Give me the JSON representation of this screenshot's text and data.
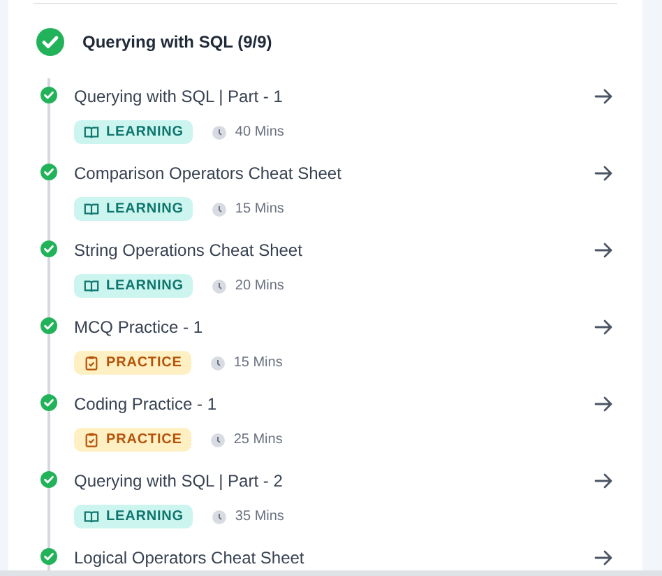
{
  "section": {
    "title": "Querying with SQL (9/9)",
    "completed": true
  },
  "items": [
    {
      "title": "Querying with SQL | Part - 1",
      "completed": true,
      "kind": "learning",
      "tag": "LEARNING",
      "duration": "40 Mins"
    },
    {
      "title": "Comparison Operators Cheat Sheet",
      "completed": true,
      "kind": "learning",
      "tag": "LEARNING",
      "duration": "15 Mins"
    },
    {
      "title": "String Operations Cheat Sheet",
      "completed": true,
      "kind": "learning",
      "tag": "LEARNING",
      "duration": "20 Mins"
    },
    {
      "title": "MCQ Practice - 1",
      "completed": true,
      "kind": "practice",
      "tag": "PRACTICE",
      "duration": "15 Mins"
    },
    {
      "title": "Coding Practice - 1",
      "completed": true,
      "kind": "practice",
      "tag": "PRACTICE",
      "duration": "25 Mins"
    },
    {
      "title": "Querying with SQL | Part - 2",
      "completed": true,
      "kind": "learning",
      "tag": "LEARNING",
      "duration": "35 Mins"
    },
    {
      "title": "Logical Operators Cheat Sheet",
      "completed": true
    }
  ]
}
